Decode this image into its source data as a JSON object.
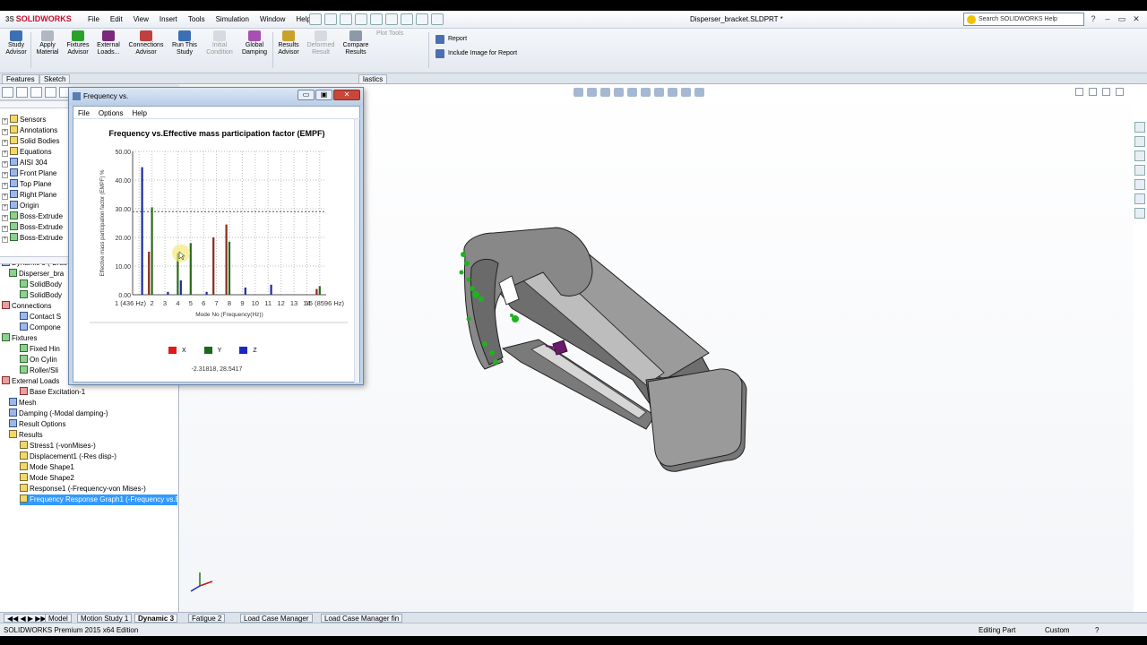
{
  "app": {
    "name": "SOLIDWORKS",
    "document_title": "Disperser_bracket.SLDPRT *",
    "search_placeholder": "Search SOLIDWORKS Help"
  },
  "menu": [
    "File",
    "Edit",
    "View",
    "Insert",
    "Tools",
    "Simulation",
    "Window",
    "Help"
  ],
  "ribbon": {
    "study_advisor": "Study Advisor",
    "apply_material": "Apply Material",
    "fixtures_advisor": "Fixtures Advisor",
    "external_loads": "External Loads...",
    "connections_advisor": "Connections Advisor",
    "run_study": "Run This Study",
    "initial_condition": "Initial Condition",
    "global_damping": "Global Damping",
    "results_advisor": "Results Advisor",
    "deformed_result": "Deformed Result",
    "compare_results": "Compare Results",
    "plot_tools": "Plot Tools",
    "report": "Report",
    "include_image": "Include Image for Report"
  },
  "tabs": {
    "features": "Features",
    "sketch": "Sketch",
    "plastics": "lastics"
  },
  "tree": {
    "part_items": [
      "Sensors",
      "Annotations",
      "Solid Bodies",
      "Equations",
      "AISI 304",
      "Front Plane",
      "Top Plane",
      "Right Plane",
      "Origin",
      "Boss-Extrude",
      "Boss-Extrude",
      "Boss-Extrude"
    ],
    "study_items": [
      "Dynamic 3 (-Brac",
      "Disperser_bra",
      "SolidBody",
      "SolidBody",
      "Connections",
      "Contact S",
      "Compone",
      "Fixtures",
      "Fixed Hin",
      "On Cylin",
      "Roller/Sli",
      "External Loads",
      "Base Excitation-1",
      "Mesh",
      "Damping (-Modal damping-)",
      "Result Options",
      "Results",
      "Stress1 (-vonMises-)",
      "Displacement1 (-Res disp-)",
      "Mode Shape1",
      "Mode Shape2",
      "Response1 (-Frequency-von Mises-)",
      "Frequency Response Graph1 (-Frequency vs.E"
    ]
  },
  "dialog": {
    "title": "Frequency vs.",
    "menu": [
      "File",
      "Options",
      "Help"
    ],
    "coords_readout": "-2.31818, 28.5417",
    "close": "✕",
    "minimize": "▭",
    "maximize": "▣"
  },
  "chart_data": {
    "type": "bar",
    "title": "Frequency vs.Effective mass participation factor (EMPF)",
    "xlabel": "Mode No (Frequency(Hz))",
    "ylabel": "Effective mass participation factor (EMPF) %",
    "ylim": [
      0,
      50
    ],
    "y_ticks": [
      "0.00",
      "10.00",
      "20.00",
      "30.00",
      "40.00",
      "50.00"
    ],
    "x_ticks": [
      "1 (436 Hz)",
      "2",
      "3",
      "4",
      "5",
      "6",
      "7",
      "8",
      "9",
      "10",
      "11",
      "12",
      "13",
      "14",
      "15 (8596 Hz)"
    ],
    "categories": [
      "1",
      "2",
      "3",
      "4",
      "5",
      "6",
      "7",
      "8",
      "9",
      "10",
      "11",
      "12",
      "13",
      "14",
      "15"
    ],
    "reference_line": 29,
    "series": [
      {
        "name": "X",
        "color": "#8b2a1a",
        "values": [
          0,
          15,
          0,
          0,
          0,
          0,
          20,
          24.5,
          0,
          0,
          0,
          0,
          0,
          0,
          2
        ]
      },
      {
        "name": "Y",
        "color": "#2a6a1a",
        "values": [
          0,
          30.5,
          0,
          14.5,
          18,
          0,
          0,
          18.5,
          0,
          0,
          0,
          0,
          0,
          0,
          3
        ]
      },
      {
        "name": "Z",
        "color": "#1a2aa0",
        "values": [
          44.5,
          0,
          1,
          5,
          0,
          1,
          0,
          0,
          2.5,
          0,
          3.5,
          0,
          0,
          0,
          0
        ]
      }
    ],
    "legend_position": "bottom",
    "grid": true
  },
  "bottom_tabs": [
    "Model",
    "Motion Study 1",
    "Dynamic 3",
    "Fatigue 2",
    "Load Case Manager",
    "Load Case Manager fin"
  ],
  "status": {
    "edition": "SOLIDWORKS Premium 2015 x64 Edition",
    "editing": "Editing Part",
    "units": "Custom"
  },
  "colors": {
    "model_gray": "#8a8a8a",
    "fixture_green": "#1db31d",
    "load_purple": "#6a1a6a",
    "selection_blue": "#3399ff"
  }
}
